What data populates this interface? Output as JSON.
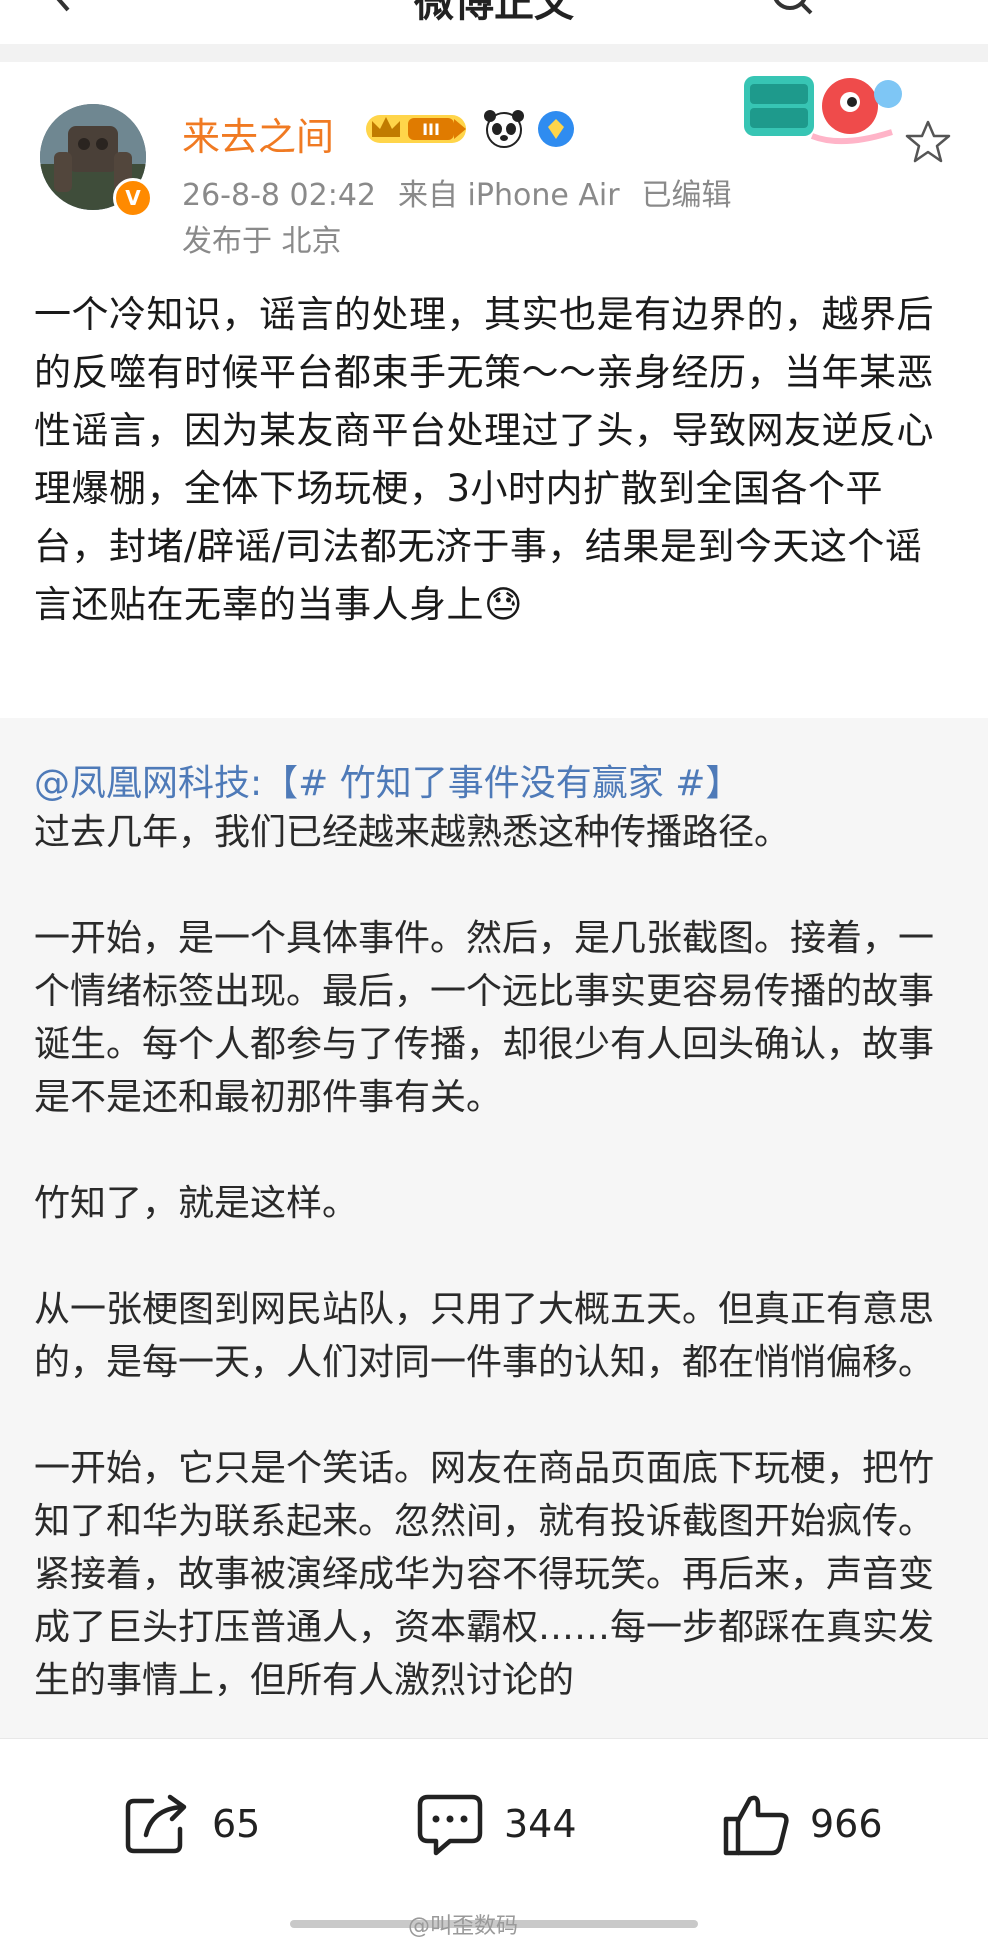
{
  "nav": {
    "title": "微博正文"
  },
  "post": {
    "author": "来去之间",
    "time": "26-8-8 02:42",
    "source": "来自 iPhone Air",
    "edited": "已编辑",
    "location": "发布于 北京",
    "level_badge": "III",
    "text": "一个冷知识，谣言的处理，其实也是有边界的，越界后的反噬有时候平台都束手无策～～亲身经历，当年某恶性谣言，因为某友商平台处理过了头，导致网友逆反心理爆棚，全体下场玩梗，3小时内扩散到全国各个平台，封堵/辟谣/司法都无济于事，结果是到今天这个谣言还贴在无辜的当事人身上😓"
  },
  "repost": {
    "source_user": "@凤凰网科技",
    "topic": ":【# 竹知了事件没有赢家 #】",
    "paragraphs": [
      "过去几年，我们已经越来越熟悉这种传播路径。",
      "一开始，是一个具体事件。然后，是几张截图。接着，一个情绪标签出现。最后，一个远比事实更容易传播的故事诞生。每个人都参与了传播，却很少有人回头确认，故事是不是还和最初那件事有关。",
      "竹知了，就是这样。",
      "从一张梗图到网民站队，只用了大概五天。但真正有意思的，是每一天，人们对同一件事的认知，都在悄悄偏移。",
      "一开始，它只是个笑话。网友在商品页面底下玩梗，把竹知了和华为联系起来。忽然间，就有投诉截图开始疯传。紧接着，故事被演绎成华为容不得玩笑。再后来，声音变成了巨头打压普通人，资本霸权……每一步都踩在真实发生的事情上，但所有人激烈讨论的"
    ]
  },
  "actions": {
    "share_count": "65",
    "comment_count": "344",
    "like_count": "966"
  },
  "watermark": "@叫歪数码",
  "colors": {
    "name": "#f07a22",
    "link": "#4e7ab8",
    "repost_bg": "#f6f6f6"
  }
}
